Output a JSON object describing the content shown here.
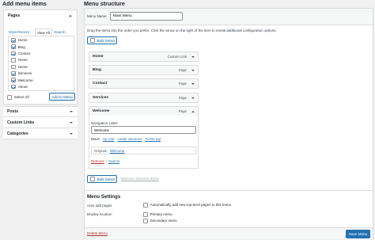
{
  "left": {
    "title": "Add menu items",
    "pages": {
      "heading": "Pages",
      "tabs": [
        "Most Recent",
        "View All",
        "Search"
      ],
      "active_tab": 1,
      "items": [
        {
          "label": "Home",
          "checked": true
        },
        {
          "label": "Blog",
          "checked": true
        },
        {
          "label": "Contact",
          "checked": true
        },
        {
          "label": "Home",
          "checked": false
        },
        {
          "label": "Home",
          "checked": false
        },
        {
          "label": "Services",
          "checked": true
        },
        {
          "label": "Welcome",
          "checked": true
        },
        {
          "label": "About",
          "checked": true
        }
      ],
      "select_all": "Select All",
      "add_button": "Add to Menu"
    },
    "sections": [
      "Posts",
      "Custom Links",
      "Categories"
    ]
  },
  "right": {
    "title": "Menu structure",
    "menu_name_label": "Menu Name",
    "menu_name_value": "Main Menu",
    "instructions": "Drag the items into the order you prefer. Click the arrow on the right of the item to reveal additional configuration options.",
    "bulk_select": "Bulk Select",
    "items": [
      {
        "label": "Home",
        "type": "Custom Link"
      },
      {
        "label": "Blog",
        "type": "Page"
      },
      {
        "label": "Contact",
        "type": "Page"
      },
      {
        "label": "Services",
        "type": "Page"
      },
      {
        "label": "Welcome",
        "type": "Page"
      }
    ],
    "expanded": {
      "nav_label_title": "Navigation Label",
      "nav_label_value": "Welcome",
      "move_label": "Move",
      "move_links": [
        "Up one",
        "Under Services",
        "To the top"
      ],
      "original_label": "Original:",
      "original_link": "Welcome",
      "remove": "Remove",
      "separator": "|",
      "cancel": "Cancel"
    },
    "bulk_select_bottom": "Bulk Select",
    "remove_selected": "Remove Selected Items",
    "settings": {
      "title": "Menu Settings",
      "auto_add_label": "Auto add pages",
      "auto_add_option": "Automatically add new top-level pages to this menu",
      "display_location_label": "Display location",
      "locations": [
        "Primary menu",
        "Secondary menu"
      ]
    },
    "delete_menu": "Delete Menu",
    "save_menu": "Save Menu"
  }
}
